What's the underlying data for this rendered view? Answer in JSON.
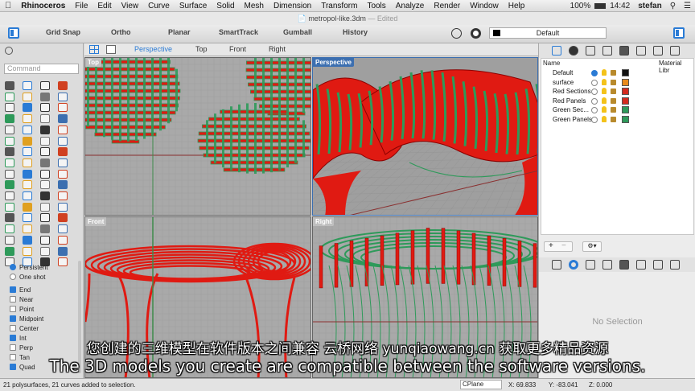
{
  "menubar": {
    "app": "Rhinoceros",
    "items": [
      "File",
      "Edit",
      "View",
      "Curve",
      "Surface",
      "Solid",
      "Mesh",
      "Dimension",
      "Transform",
      "Tools",
      "Analyze",
      "Render",
      "Window",
      "Help"
    ],
    "battery": "100%",
    "time": "14:42",
    "user": "stefan"
  },
  "window": {
    "filename": "metropol-like.3dm",
    "state": "Edited"
  },
  "toolbar": {
    "buttons": [
      "Grid Snap",
      "Ortho",
      "Planar",
      "SmartTrack",
      "Gumball",
      "History"
    ],
    "layer": "Default"
  },
  "command": {
    "placeholder": "Command"
  },
  "viewport_tabs": [
    "Perspective",
    "Top",
    "Front",
    "Right"
  ],
  "viewports": {
    "top": "Top",
    "perspective": "Perspective",
    "front": "Front",
    "right": "Right"
  },
  "osnap": {
    "persistent": "Persistent",
    "one_shot": "One shot",
    "items": [
      {
        "label": "End",
        "on": true
      },
      {
        "label": "Near",
        "on": false
      },
      {
        "label": "Point",
        "on": false
      },
      {
        "label": "Midpoint",
        "on": true
      },
      {
        "label": "Center",
        "on": false
      },
      {
        "label": "Int",
        "on": true
      },
      {
        "label": "Perp",
        "on": false
      },
      {
        "label": "Tan",
        "on": false
      },
      {
        "label": "Quad",
        "on": true
      }
    ]
  },
  "layers": {
    "col_name": "Name",
    "col_material": "Material Libr",
    "rows": [
      {
        "name": "Default",
        "color": "#111111",
        "current": true
      },
      {
        "name": "surface",
        "color": "#e88a1c",
        "current": false
      },
      {
        "name": "Red Sections",
        "color": "#d42a1f",
        "current": false
      },
      {
        "name": "Red Panels",
        "color": "#d42a1f",
        "current": false
      },
      {
        "name": "Green Sec...",
        "color": "#2e9a5a",
        "current": false
      },
      {
        "name": "Green Panels",
        "color": "#2e9a5a",
        "current": false
      }
    ],
    "add": "+",
    "remove": "−"
  },
  "properties": {
    "empty": "No Selection"
  },
  "status": {
    "message": "21 polysurfaces, 21 curves added to selection.",
    "cplane": "CPlane",
    "x": "X: 69.833",
    "y": "Y: -83.041",
    "z": "Z: 0.000"
  },
  "subtitles": {
    "zh": "您创建的三维模型在软件版本之间兼容  云桥网络 yunqiaowang.cn  获取更多精品资源",
    "en": "The 3D models you create are compatible between the software versions."
  },
  "colors": {
    "red": "#e01a12",
    "green": "#2e9a5a",
    "accent": "#2a7bd5"
  }
}
